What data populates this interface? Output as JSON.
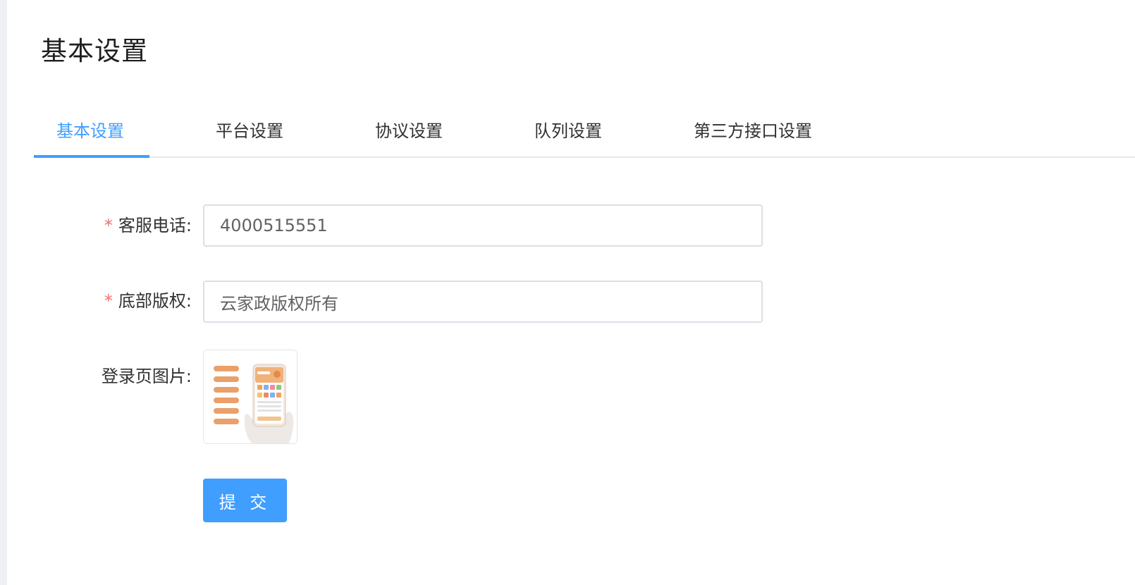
{
  "page": {
    "title": "基本设置"
  },
  "tabs": [
    {
      "label": "基本设置",
      "active": true
    },
    {
      "label": "平台设置",
      "active": false
    },
    {
      "label": "协议设置",
      "active": false
    },
    {
      "label": "队列设置",
      "active": false
    },
    {
      "label": "第三方接口设置",
      "active": false
    }
  ],
  "form": {
    "required_mark": "*",
    "phone": {
      "label": "客服电话:",
      "value": "4000515551"
    },
    "copyright": {
      "label": "底部版权:",
      "value": "云家政版权所有"
    },
    "login_image": {
      "label": "登录页图片:"
    },
    "submit_label": "提 交"
  },
  "colors": {
    "accent": "#409eff",
    "required": "#f56c6c",
    "border": "#dcdfe6",
    "thumbnail_accent": "#e9a06a"
  }
}
